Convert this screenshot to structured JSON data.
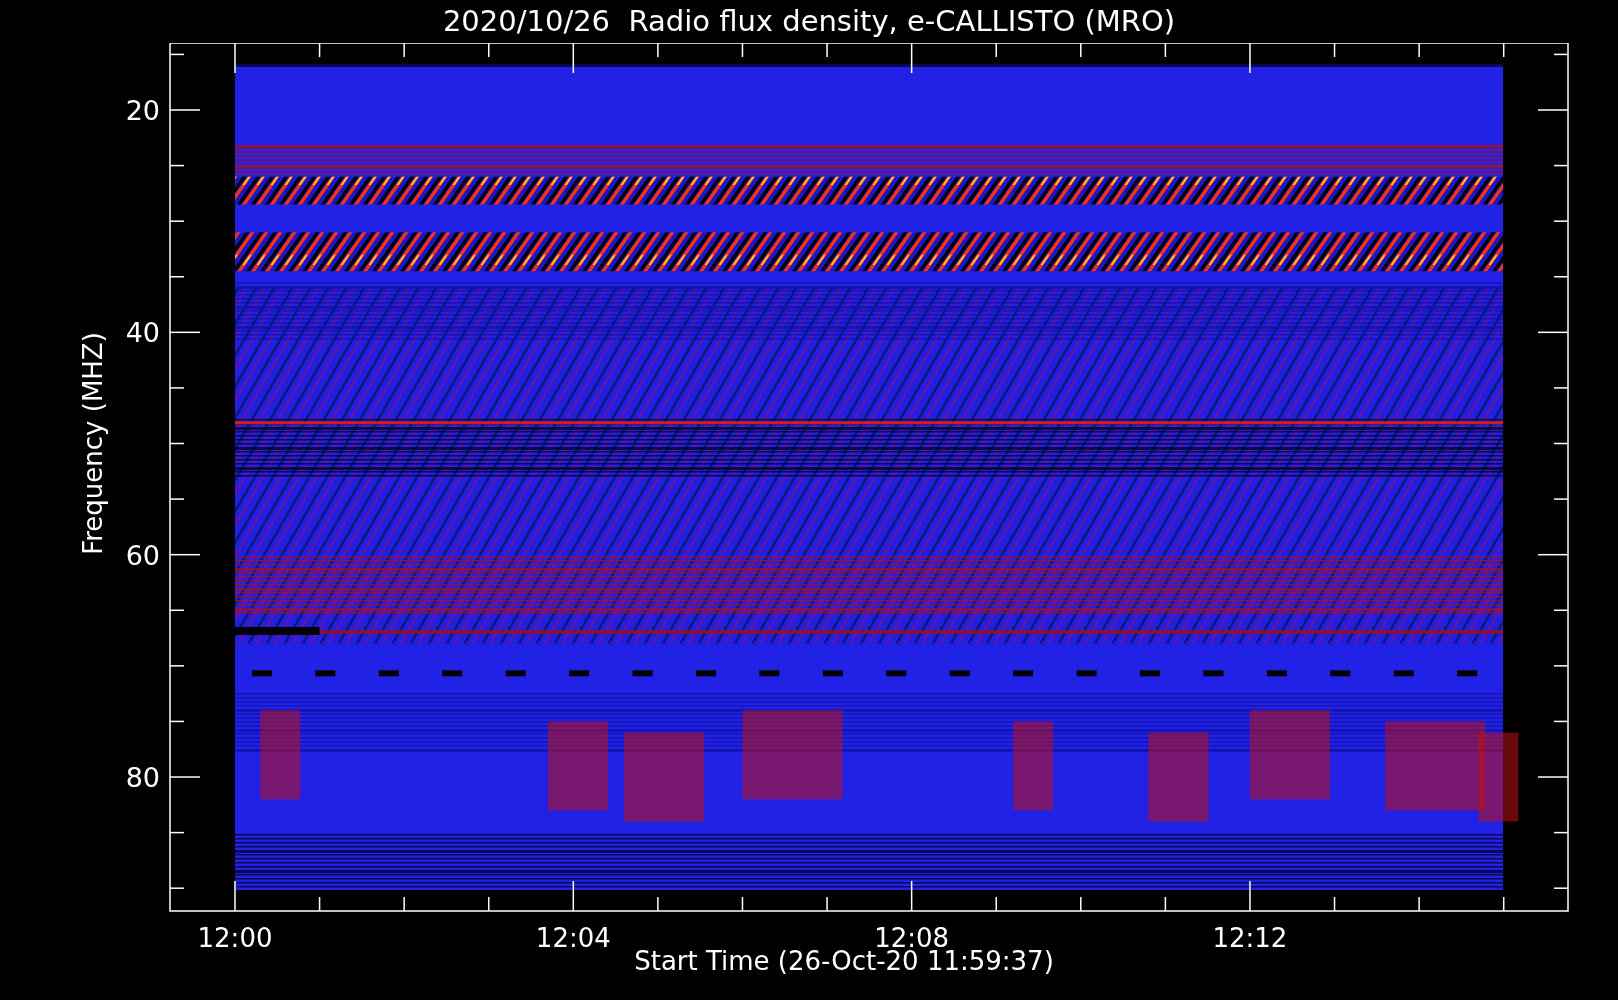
{
  "title": "2020/10/26  Radio flux density, e-CALLISTO (MRO)",
  "y_axis": {
    "label": "Frequency (MHZ)",
    "ticks": [
      "20",
      "40",
      "60",
      "80"
    ]
  },
  "x_axis": {
    "label": "Start Time (26-Oct-20 11:59:37)",
    "ticks": [
      "12:00",
      "12:04",
      "12:08",
      "12:12"
    ]
  }
}
